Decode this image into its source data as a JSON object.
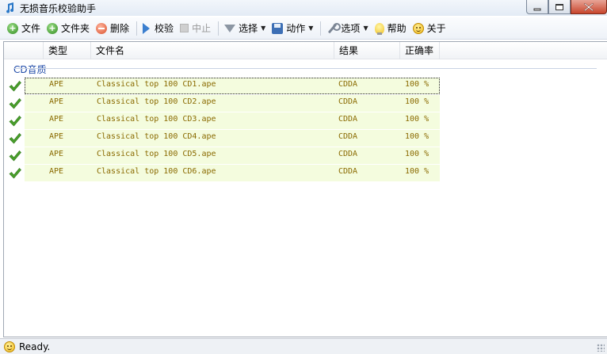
{
  "window": {
    "title": "无损音乐校验助手"
  },
  "toolbar": {
    "items": [
      {
        "label": "文件",
        "icon": "add-icon"
      },
      {
        "label": "文件夹",
        "icon": "add-folder-icon"
      },
      {
        "label": "删除",
        "icon": "delete-icon"
      },
      {
        "label": "校验",
        "icon": "play-icon"
      },
      {
        "label": "中止",
        "icon": "stop-icon",
        "disabled": true
      },
      {
        "label": "选择",
        "icon": "filter-icon",
        "dropdown": true
      },
      {
        "label": "动作",
        "icon": "save-icon",
        "dropdown": true
      },
      {
        "label": "选项",
        "icon": "wrench-icon",
        "dropdown": true
      },
      {
        "label": "帮助",
        "icon": "lightbulb-icon"
      },
      {
        "label": "关于",
        "icon": "smiley-icon"
      }
    ]
  },
  "table": {
    "columns": [
      "类型",
      "文件名",
      "结果",
      "正确率"
    ],
    "group": "CD音质",
    "rows": [
      {
        "type": "APE",
        "filename": "Classical top 100 CD1.ape",
        "result": "CDDA",
        "accuracy": "100 %"
      },
      {
        "type": "APE",
        "filename": "Classical top 100 CD2.ape",
        "result": "CDDA",
        "accuracy": "100 %"
      },
      {
        "type": "APE",
        "filename": "Classical top 100 CD3.ape",
        "result": "CDDA",
        "accuracy": "100 %"
      },
      {
        "type": "APE",
        "filename": "Classical top 100 CD4.ape",
        "result": "CDDA",
        "accuracy": "100 %"
      },
      {
        "type": "APE",
        "filename": "Classical top 100 CD5.ape",
        "result": "CDDA",
        "accuracy": "100 %"
      },
      {
        "type": "APE",
        "filename": "Classical top 100 CD6.ape",
        "result": "CDDA",
        "accuracy": "100 %"
      }
    ]
  },
  "status": {
    "text": "Ready."
  },
  "colors": {
    "row_bg": "#f4fcde",
    "row_text": "#8a6a00",
    "check": "#4aa02c",
    "group_text": "#1f4aa8"
  }
}
